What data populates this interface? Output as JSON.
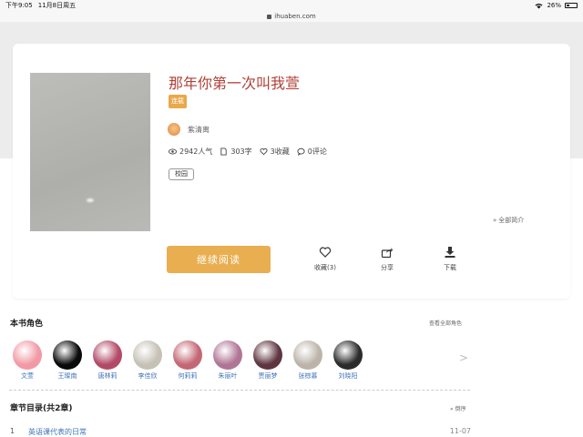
{
  "status_bar": {
    "time": "下午9:05",
    "date": "11月8日周五",
    "battery": "26%"
  },
  "url_bar": {
    "domain": "ihuaben.com"
  },
  "book": {
    "title": "那年你第一次叫我萱",
    "badge": "连载",
    "author": "紫清离",
    "stats": {
      "popularity": "2942人气",
      "words": "303字",
      "favorites": "3收藏",
      "comments": "0评论"
    },
    "tag": "校园",
    "intro_toggle": "全部简介"
  },
  "actions": {
    "read": "继续阅读",
    "favorite": "收藏(3)",
    "share": "分享",
    "download": "下载"
  },
  "roles_section": {
    "title": "本书角色",
    "view_all": "查看全部角色",
    "next_arrow": ">",
    "roles": [
      {
        "name": "文萱",
        "color": "#f19aa5"
      },
      {
        "name": "王璨南",
        "color": "#0a0a0a"
      },
      {
        "name": "唐林莉",
        "color": "#b24a67"
      },
      {
        "name": "李佳欣",
        "color": "#c6c1b6"
      },
      {
        "name": "何莉莉",
        "color": "#c46775"
      },
      {
        "name": "朱丽叶",
        "color": "#b07596"
      },
      {
        "name": "贾丽梦",
        "color": "#5e3540"
      },
      {
        "name": "张棕慕",
        "color": "#bcb4aa"
      },
      {
        "name": "刘晓阳",
        "color": "#2b2b2b"
      }
    ]
  },
  "chapters_section": {
    "title": "章节目录(共2章)",
    "order": "倒序",
    "items": [
      {
        "num": "1",
        "name": "英语课代表的日常",
        "date": "11-07"
      }
    ]
  },
  "colors": {
    "accent": "#e9ae50",
    "title": "#b04038",
    "link": "#3e72b8"
  }
}
